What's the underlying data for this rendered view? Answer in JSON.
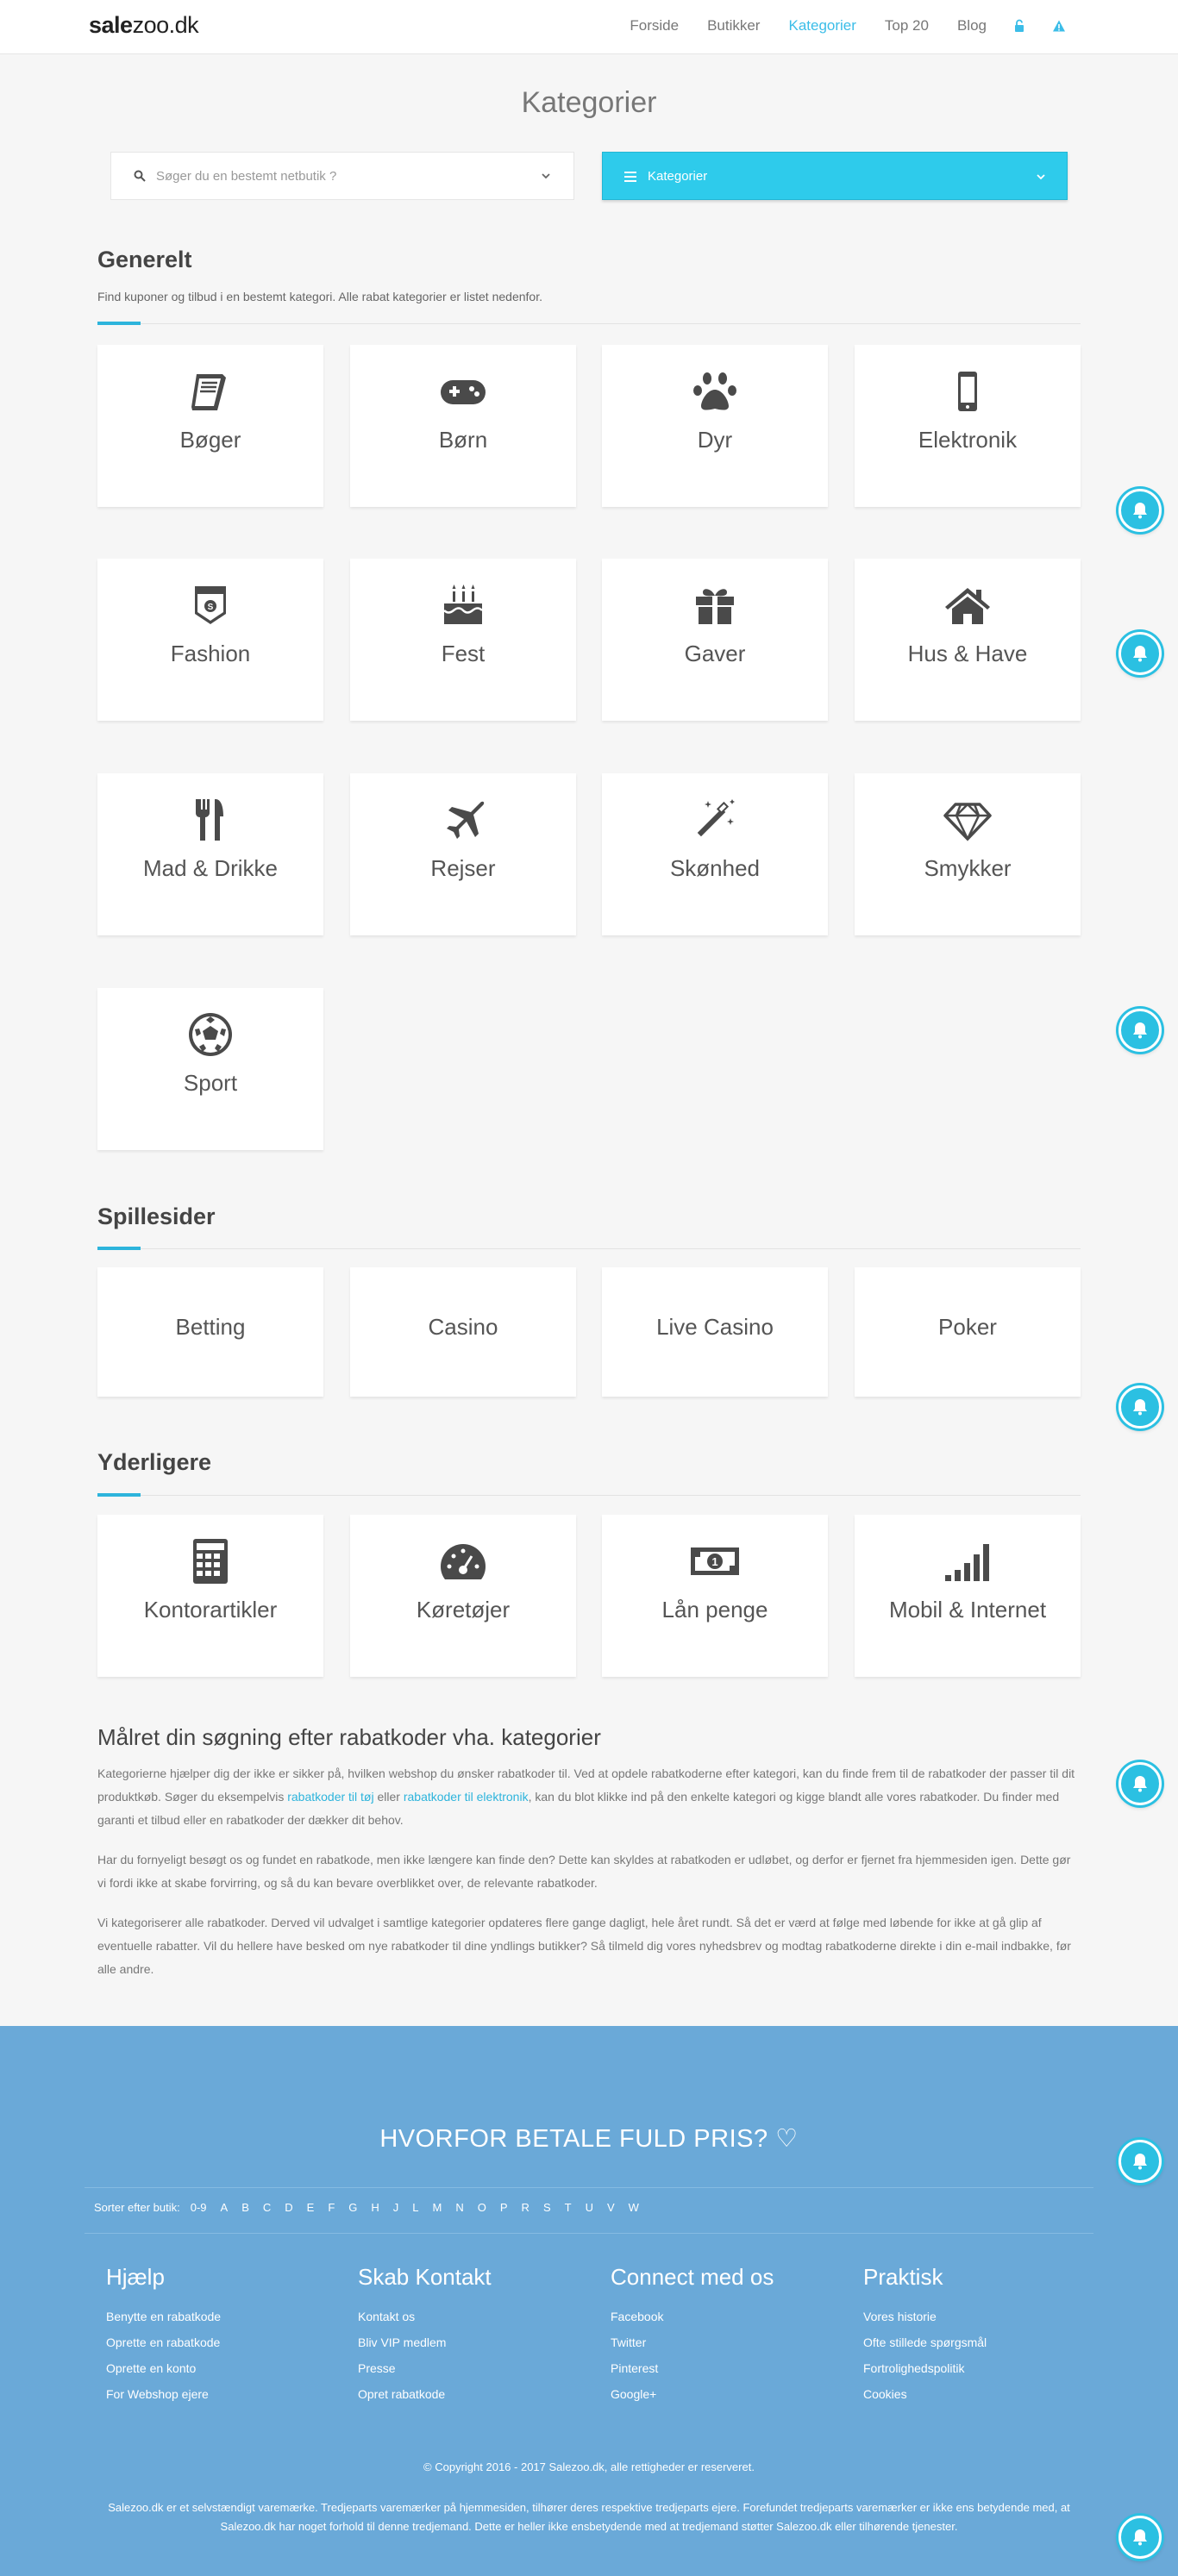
{
  "header": {
    "logo_bold": "sale",
    "logo_rest": "zoo.dk",
    "nav": [
      "Forside",
      "Butikker",
      "Kategorier",
      "Top 20",
      "Blog"
    ],
    "active_nav": "Kategorier"
  },
  "page": {
    "title": "Kategorier",
    "search_placeholder": "Søger du en bestemt netbutik ?",
    "category_select_label": "Kategorier"
  },
  "generelt": {
    "title": "Generelt",
    "subtitle": "Find kuponer og tilbud i en bestemt kategori. Alle rabat kategorier er listet nedenfor.",
    "items": [
      {
        "label": "Bøger",
        "icon": "book-icon"
      },
      {
        "label": "Børn",
        "icon": "gamepad-icon"
      },
      {
        "label": "Dyr",
        "icon": "paw-icon"
      },
      {
        "label": "Elektronik",
        "icon": "mobile-icon"
      },
      {
        "label": "Fashion",
        "icon": "pocket-icon"
      },
      {
        "label": "Fest",
        "icon": "cake-icon"
      },
      {
        "label": "Gaver",
        "icon": "gift-icon"
      },
      {
        "label": "Hus & Have",
        "icon": "house-icon"
      },
      {
        "label": "Mad & Drikke",
        "icon": "cutlery-icon"
      },
      {
        "label": "Rejser",
        "icon": "plane-icon"
      },
      {
        "label": "Skønhed",
        "icon": "magic-wand-icon"
      },
      {
        "label": "Smykker",
        "icon": "diamond-icon"
      },
      {
        "label": "Sport",
        "icon": "soccer-ball-icon"
      }
    ]
  },
  "spillesider": {
    "title": "Spillesider",
    "items": [
      "Betting",
      "Casino",
      "Live Casino",
      "Poker"
    ]
  },
  "yderligere": {
    "title": "Yderligere",
    "items": [
      {
        "label": "Kontorartikler",
        "icon": "calculator-icon"
      },
      {
        "label": "Køretøjer",
        "icon": "dashboard-icon"
      },
      {
        "label": "Lån penge",
        "icon": "money-icon"
      },
      {
        "label": "Mobil & Internet",
        "icon": "signal-icon"
      }
    ]
  },
  "seo": {
    "title": "Målret din søgning efter rabatkoder vha. kategorier",
    "p1_a": "Kategorierne hjælper dig der ikke er sikker på, hvilken webshop du ønsker rabatkoder til. Ved at opdele rabatkoderne efter kategori, kan du finde frem til de rabatkoder der passer til dit produktkøb. Søger du eksempelvis ",
    "p1_link1": "rabatkoder til tøj",
    "p1_b": " eller ",
    "p1_link2": "rabatkoder til elektronik",
    "p1_c": ", kan du blot klikke ind på den enkelte kategori og kigge blandt alle vores rabatkoder. Du finder med garanti et tilbud eller en rabatkoder der dækker dit behov.",
    "p2": "Har du fornyeligt besøgt os og fundet en rabatkode, men ikke længere kan finde den? Dette kan skyldes at rabatkoden er udløbet, og derfor er fjernet fra hjemmesiden igen. Dette gør vi fordi ikke at skabe forvirring, og så du kan bevare overblikket over, de relevante rabatkoder.",
    "p3": "Vi kategoriserer alle rabatkoder. Derved vil udvalget i samtlige kategorier opdateres flere gange dagligt, hele året rundt. Så det er værd at følge med løbende for ikke at gå glip af eventuelle rabatter. Vil du hellere have besked om nye rabatkoder til dine yndlings butikker? Så tilmeld dig vores nyhedsbrev og modtag rabatkoderne direkte i din e-mail indbakke, før alle andre."
  },
  "footer": {
    "headline": "HVORFOR BETALE FULD PRIS? ♡",
    "sort_label": "Sorter efter butik:",
    "letters": [
      "0-9",
      "A",
      "B",
      "C",
      "D",
      "E",
      "F",
      "G",
      "H",
      "J",
      "L",
      "M",
      "N",
      "O",
      "P",
      "R",
      "S",
      "T",
      "U",
      "V",
      "W"
    ],
    "columns": [
      {
        "title": "Hjælp",
        "links": [
          "Benytte en rabatkode",
          "Oprette en rabatkode",
          "Oprette en konto",
          "For Webshop ejere"
        ]
      },
      {
        "title": "Skab Kontakt",
        "links": [
          "Kontakt os",
          "Bliv VIP medlem",
          "Presse",
          "Opret rabatkode"
        ]
      },
      {
        "title": "Connect med os",
        "links": [
          "Facebook",
          "Twitter",
          "Pinterest",
          "Google+"
        ]
      },
      {
        "title": "Praktisk",
        "links": [
          "Vores historie",
          "Ofte stillede spørgsmål",
          "Fortrolighedspolitik",
          "Cookies"
        ]
      }
    ],
    "copyright": "© Copyright 2016 - 2017 Salezoo.dk, alle rettigheder er reserveret.",
    "disclaimer": "Salezoo.dk er et selvstændigt varemærke. Tredjeparts varemærker på hjemmesiden, tilhører deres respektive tredjeparts ejere. Forefundet tredjeparts varemærker er ikke ens betydende med, at Salezoo.dk har noget forhold til denne tredjemand. Dette er heller ikke ensbetydende med at tredjemand støtter Salezoo.dk eller tilhørende tjenester."
  }
}
